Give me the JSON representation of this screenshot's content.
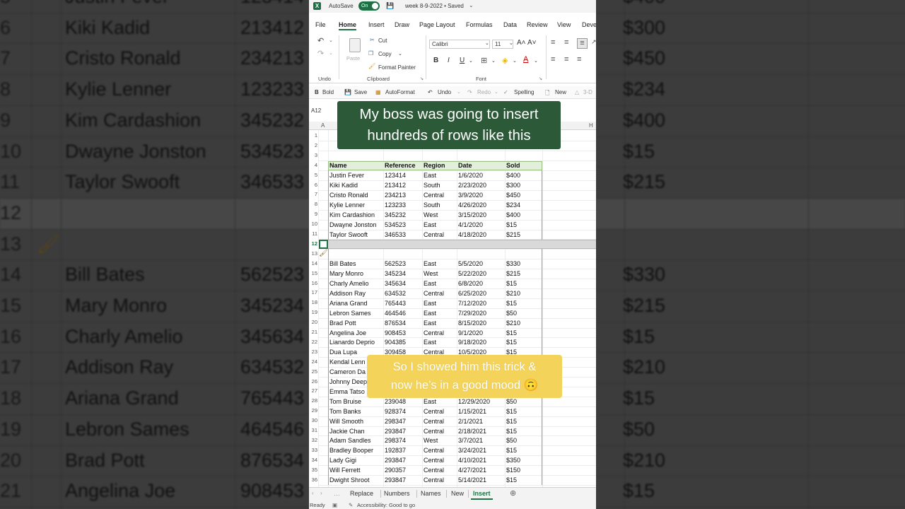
{
  "app": {
    "autosave_label": "AutoSave",
    "autosave_state": "On",
    "document_title": "week 8-9-2022 • Saved",
    "logo_letter": "X"
  },
  "menu": [
    "File",
    "Home",
    "Insert",
    "Draw",
    "Page Layout",
    "Formulas",
    "Data",
    "Review",
    "View",
    "Deve"
  ],
  "ribbon": {
    "cut": "Cut",
    "copy": "Copy",
    "paste": "Paste",
    "format_painter": "Format Painter",
    "clipboard_label": "Clipboard",
    "undo_label": "Undo",
    "font_name": "Calibri",
    "font_size": "11",
    "font_label": "Font",
    "bold_glyph": "B",
    "italic_glyph": "I",
    "underline_glyph": "U",
    "grow_glyph": "A˄",
    "shrink_glyph": "A˅"
  },
  "quick_access": {
    "bold": "Bold",
    "save": "Save",
    "autoformat": "AutoFormat",
    "undo": "Undo",
    "redo": "Redo",
    "spelling": "Spelling",
    "new": "New",
    "more": "3-D"
  },
  "name_box": "A12",
  "column_headers": [
    "A",
    "H"
  ],
  "table": {
    "headers": [
      "Name",
      "Reference",
      "Region",
      "Date",
      "Sold"
    ],
    "rows_before": [
      [
        "Justin Fever",
        "123414",
        "East",
        "1/6/2020",
        "$400"
      ],
      [
        "Kiki Kadid",
        "213412",
        "South",
        "2/23/2020",
        "$300"
      ],
      [
        "Cristo Ronald",
        "234213",
        "Central",
        "3/9/2020",
        "$450"
      ],
      [
        "Kylie Lenner",
        "123233",
        "South",
        "4/26/2020",
        "$234"
      ],
      [
        "Kim Cardashion",
        "345232",
        "West",
        "3/15/2020",
        "$400"
      ],
      [
        "Dwayne Jonston",
        "534523",
        "East",
        "4/1/2020",
        "$15"
      ],
      [
        "Taylor Swooft",
        "346533",
        "Central",
        "4/18/2020",
        "$215"
      ]
    ],
    "rows_after": [
      [
        "Bill Bates",
        "562523",
        "East",
        "5/5/2020",
        "$330"
      ],
      [
        "Mary Monro",
        "345234",
        "West",
        "5/22/2020",
        "$215"
      ],
      [
        "Charly Amelio",
        "345634",
        "East",
        "6/8/2020",
        "$15"
      ],
      [
        "Addison Ray",
        "634532",
        "Central",
        "6/25/2020",
        "$210"
      ],
      [
        "Ariana Grand",
        "765443",
        "East",
        "7/12/2020",
        "$15"
      ],
      [
        "Lebron Sames",
        "464546",
        "East",
        "7/29/2020",
        "$50"
      ],
      [
        "Brad Pott",
        "876534",
        "East",
        "8/15/2020",
        "$210"
      ],
      [
        "Angelina Joe",
        "908453",
        "Central",
        "9/1/2020",
        "$15"
      ],
      [
        "Lianardo Deprio",
        "904385",
        "East",
        "9/18/2020",
        "$15"
      ],
      [
        "Dua Lupa",
        "309458",
        "Central",
        "10/5/2020",
        "$15"
      ],
      [
        "Kendal Lenn",
        "",
        "",
        "",
        ""
      ],
      [
        "Cameron Da",
        "",
        "",
        "",
        ""
      ],
      [
        "Johnny Deep",
        "",
        "",
        "",
        ""
      ],
      [
        "Emma Tatso",
        "",
        "",
        "",
        ""
      ],
      [
        "Tom Bruise",
        "239048",
        "East",
        "12/29/2020",
        "$50"
      ],
      [
        "Tom Banks",
        "928374",
        "Central",
        "1/15/2021",
        "$15"
      ],
      [
        "Will Smooth",
        "298347",
        "Central",
        "2/1/2021",
        "$15"
      ],
      [
        "Jackie Chan",
        "293847",
        "Central",
        "2/18/2021",
        "$15"
      ],
      [
        "Adam Sandles",
        "298374",
        "West",
        "3/7/2021",
        "$50"
      ],
      [
        "Bradley Booper",
        "192837",
        "Central",
        "3/24/2021",
        "$15"
      ],
      [
        "Lady Gigi",
        "293847",
        "Central",
        "4/10/2021",
        "$350"
      ],
      [
        "Will Ferrett",
        "290357",
        "Central",
        "4/27/2021",
        "$150"
      ],
      [
        "Dwight Shroot",
        "293847",
        "Central",
        "5/14/2021",
        "$15"
      ]
    ]
  },
  "row_numbers": [
    "1",
    "2",
    "3",
    "4",
    "5",
    "6",
    "7",
    "8",
    "9",
    "10",
    "11",
    "12",
    "13",
    "14",
    "15",
    "16",
    "17",
    "18",
    "19",
    "20",
    "21",
    "22",
    "23",
    "24",
    "25",
    "26",
    "27",
    "28",
    "29",
    "30",
    "31",
    "32",
    "33",
    "34",
    "35",
    "36"
  ],
  "sheet_tabs": [
    "Replace",
    "Numbers",
    "Names",
    "New",
    "Insert"
  ],
  "active_sheet": "Insert",
  "status": {
    "ready": "Ready",
    "accessibility": "Accessibility: Good to go"
  },
  "captions": {
    "top_line1": "My boss was going to insert",
    "top_line2": "hundreds of rows like this",
    "bottom_line1": "So I showed him this trick &",
    "bottom_line2": "now he’s in a good mood 🙃"
  },
  "background": {
    "left_rows": [
      {
        "num": "5",
        "name": "Justin Fever",
        "ref": "123414"
      },
      {
        "num": "6",
        "name": "Kiki Kadid",
        "ref": "213412"
      },
      {
        "num": "7",
        "name": "Cristo Ronald",
        "ref": "234213"
      },
      {
        "num": "8",
        "name": "Kylie Lenner",
        "ref": "123233"
      },
      {
        "num": "9",
        "name": "Kim Cardashion",
        "ref": "345232"
      },
      {
        "num": "10",
        "name": "Dwayne Jonston",
        "ref": "534523"
      },
      {
        "num": "11",
        "name": "Taylor Swooft",
        "ref": "346533"
      },
      {
        "num": "12",
        "name": "",
        "ref": ""
      },
      {
        "num": "13",
        "name": "",
        "ref": ""
      },
      {
        "num": "14",
        "name": "Bill Bates",
        "ref": "562523"
      },
      {
        "num": "15",
        "name": "Mary Monro",
        "ref": "345234"
      },
      {
        "num": "16",
        "name": "Charly Amelio",
        "ref": "345634"
      },
      {
        "num": "17",
        "name": "Addison Ray",
        "ref": "634532"
      },
      {
        "num": "18",
        "name": "Ariana Grand",
        "ref": "765443"
      },
      {
        "num": "19",
        "name": "Lebron Sames",
        "ref": "464546"
      },
      {
        "num": "20",
        "name": "Brad Pott",
        "ref": "876534"
      },
      {
        "num": "21",
        "name": "Angelina Joe",
        "ref": "908453"
      }
    ],
    "right_values": [
      "$400",
      "$300",
      "$450",
      "$234",
      "$400",
      "$15",
      "$215",
      "",
      "",
      "$330",
      "$215",
      "$15",
      "$210",
      "$15",
      "$50",
      "$210",
      "$15"
    ]
  },
  "colors": {
    "excel_green": "#1e7145",
    "caption_top_bg": "#2c5938",
    "caption_bottom_bg": "#f3d35a",
    "header_fill": "#e2efda"
  }
}
